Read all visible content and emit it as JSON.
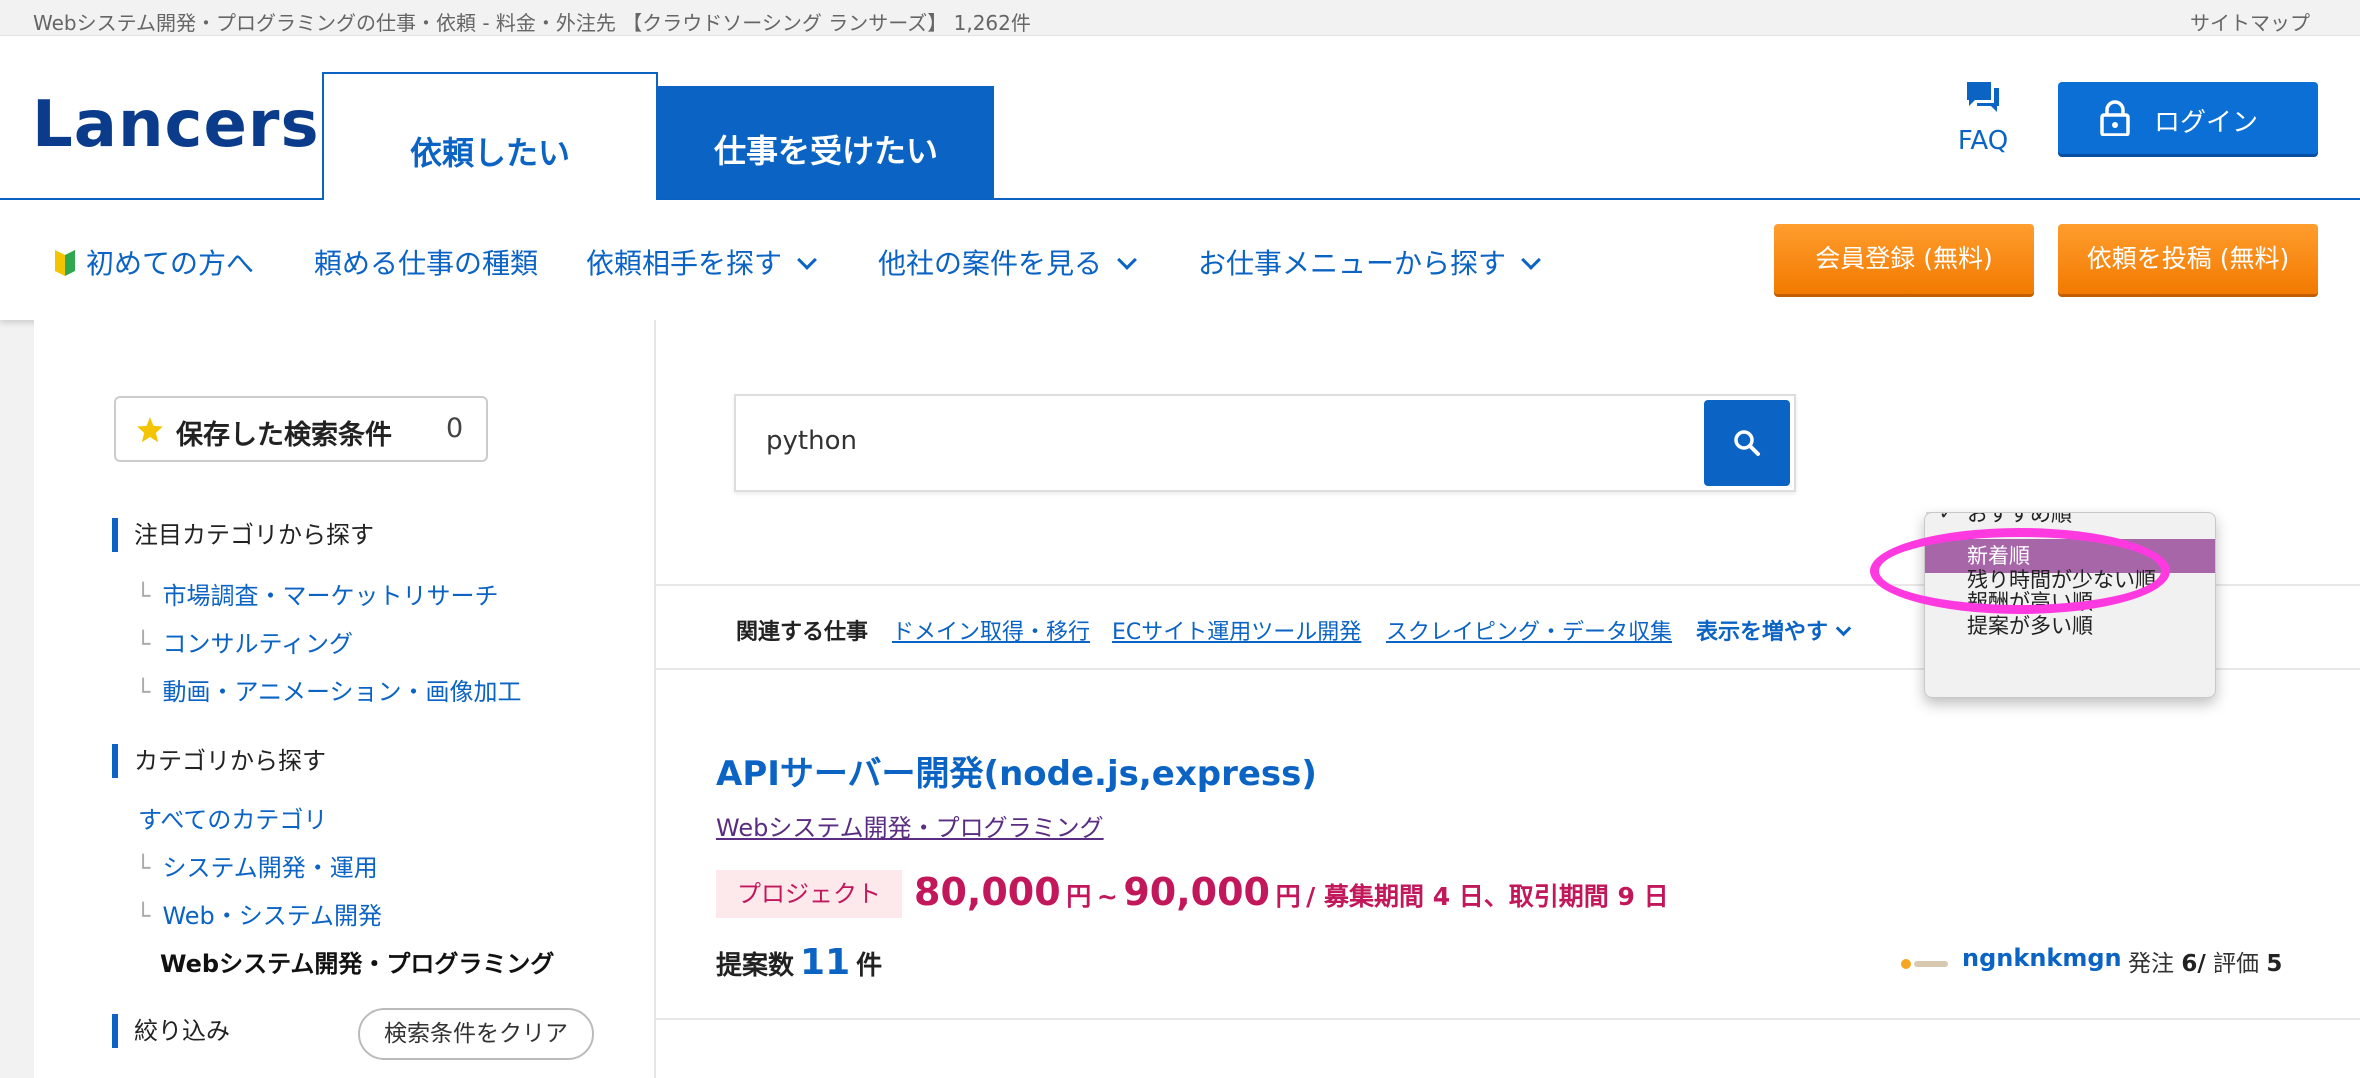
{
  "top_strip": {
    "breadcrumb": "Webシステム開発・プログラミングの仕事・依頼 - 料金・外注先 【クラウドソーシング ランサーズ】 1,262件",
    "sitemap": "サイトマップ"
  },
  "header": {
    "logo": "Lancers",
    "tab_client": "依頼したい",
    "tab_worker": "仕事を受けたい",
    "faq": "FAQ",
    "login": "ログイン"
  },
  "nav": {
    "first_time": "初めての方へ",
    "job_types": "頼める仕事の種類",
    "find_partner": "依頼相手を探す",
    "other_projects": "他社の案件を見る",
    "from_menu": "お仕事メニューから探す",
    "register": "会員登録 (無料)",
    "post_job": "依頼を投稿 (無料)"
  },
  "sidebar": {
    "saved_label": "保存した検索条件",
    "saved_count": "0",
    "featured_heading": "注目カテゴリから探す",
    "featured": [
      "市場調査・マーケットリサーチ",
      "コンサルティング",
      "動画・アニメーション・画像加工"
    ],
    "category_heading": "カテゴリから探す",
    "all_categories": "すべてのカテゴリ",
    "cat_system": "システム開発・運用",
    "cat_web": "Web・システム開発",
    "cat_current": "Webシステム開発・プログラミング",
    "filter_heading": "絞り込み",
    "clear_button": "検索条件をクリア"
  },
  "search": {
    "value": "python"
  },
  "related": {
    "heading": "関連する仕事",
    "links": [
      "ドメイン取得・移行",
      "ECサイト運用ツール開発",
      "スクレイピング・データ収集"
    ],
    "more": "表示を増やす"
  },
  "sort_dropdown": {
    "options": [
      "おすすめ順",
      "新着順",
      "残り時間が少ない順",
      "報酬が高い順",
      "提案が多い順"
    ],
    "selected": "新着順",
    "check_glyph": "✓"
  },
  "job": {
    "title": "APIサーバー開発(node.js,express)",
    "category": "Webシステム開発・プログラミング",
    "type_tag": "プロジェクト",
    "price_min": "80,000",
    "price_max": "90,000",
    "yen": "円",
    "tilde": "~",
    "period": "/ 募集期間 4 日、取引期間 9 日",
    "proposals_label": "提案数",
    "proposals_count": "11",
    "proposals_unit": "件",
    "client_name": "ngnknkmgn",
    "orders_label": "発注",
    "orders_count": "6/",
    "rating_label": "評価",
    "rating_value": "5"
  },
  "colors": {
    "brand_blue": "#0b63c4",
    "orange": "#f27a00",
    "price_red": "#c2185b",
    "annotation_magenta": "#ff39e0",
    "dropdown_highlight": "#a666a8"
  }
}
